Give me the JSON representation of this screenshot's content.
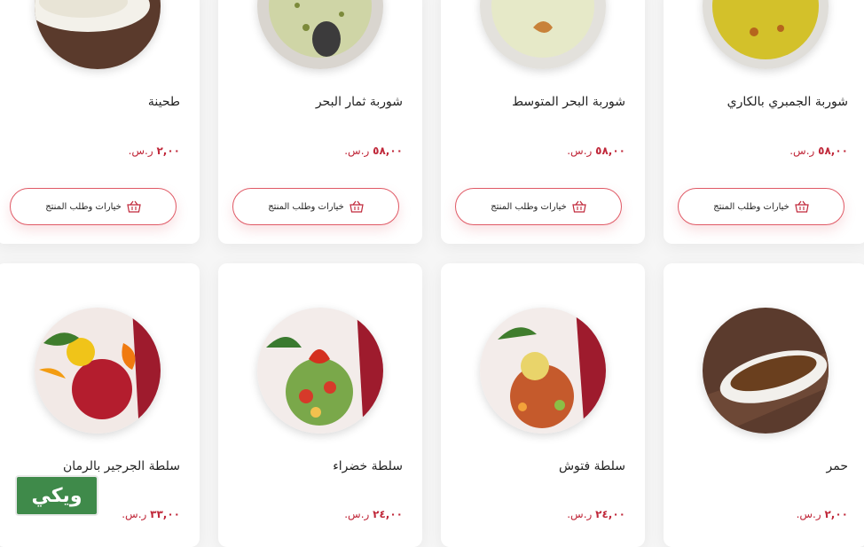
{
  "currency": "ر.س.",
  "button_label": "خيارات وطلب المنتج",
  "brand_badge": "ويكي",
  "row1": [
    {
      "name": "طحينة",
      "price": "٢,٠٠"
    },
    {
      "name": "شوربة ثمار البحر",
      "price": "٥٨,٠٠"
    },
    {
      "name": "شوربة البحر المتوسط",
      "price": "٥٨,٠٠"
    },
    {
      "name": "شوربة الجمبري بالكاري",
      "price": "٥٨,٠٠"
    }
  ],
  "row2": [
    {
      "name": "سلطة الجرجير بالرمان",
      "price": "٣٣,٠٠"
    },
    {
      "name": "سلطة خضراء",
      "price": "٢٤,٠٠"
    },
    {
      "name": "سلطة فتوش",
      "price": "٢٤,٠٠"
    },
    {
      "name": "حمر",
      "price": "٢,٠٠"
    }
  ],
  "colors": {
    "accent": "#c0283a",
    "button_border": "#e05a66",
    "badge": "#3f8a4a"
  },
  "icons": {
    "basket": "basket-icon"
  }
}
